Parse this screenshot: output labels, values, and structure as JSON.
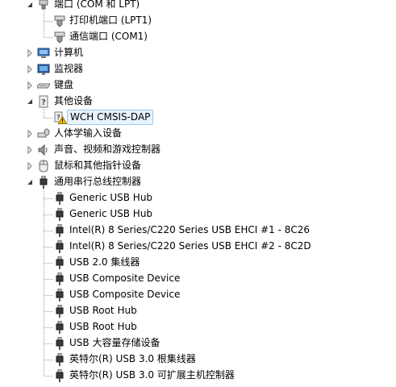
{
  "tree": {
    "ports": {
      "label": "端口 (COM 和 LPT)",
      "children": [
        "打印机端口 (LPT1)",
        "通信端口 (COM1)"
      ]
    },
    "computer": {
      "label": "计算机"
    },
    "monitors": {
      "label": "监视器"
    },
    "keyboards": {
      "label": "键盘"
    },
    "other_devices": {
      "label": "其他设备",
      "children": [
        "WCH CMSIS-DAP"
      ]
    },
    "hid": {
      "label": "人体学输入设备"
    },
    "sound": {
      "label": "声音、视频和游戏控制器"
    },
    "mice": {
      "label": "鼠标和其他指针设备"
    },
    "usb": {
      "label": "通用串行总线控制器",
      "children": [
        "Generic USB Hub",
        "Generic USB Hub",
        "Intel(R) 8 Series/C220 Series USB EHCI #1 - 8C26",
        "Intel(R) 8 Series/C220 Series USB EHCI #2 - 8C2D",
        "USB 2.0 集线器",
        "USB Composite Device",
        "USB Composite Device",
        "USB Root Hub",
        "USB Root Hub",
        "USB 大容量存储设备",
        "英特尔(R) USB 3.0 根集线器",
        "英特尔(R) USB 3.0 可扩展主机控制器"
      ]
    }
  },
  "colors": {
    "selection_bg": "#e8f3fc",
    "selection_border": "#9cc9ec",
    "warning": "#f2c200"
  },
  "icons": {
    "port": "port-connector-icon",
    "computer": "computer-icon",
    "monitor": "monitor-icon",
    "keyboard": "keyboard-icon",
    "unknown": "unknown-device-icon",
    "warning": "warning-icon",
    "hid": "hid-device-icon",
    "sound": "speaker-icon",
    "mouse": "mouse-icon",
    "usb": "usb-plug-icon"
  }
}
